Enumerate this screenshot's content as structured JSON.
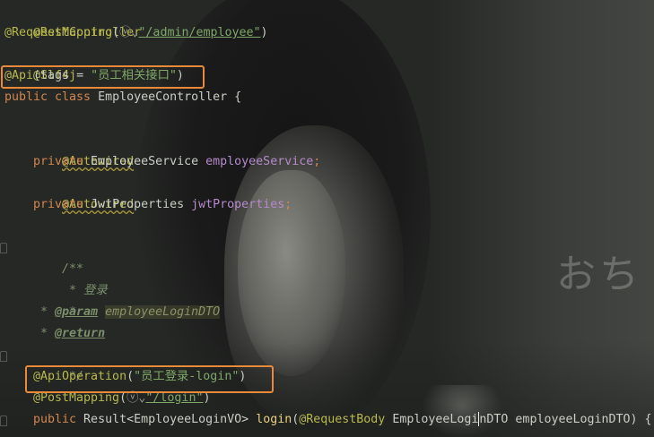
{
  "code_lines": {
    "l1": {
      "ann": "@RestController"
    },
    "l2": {
      "ann": "@RequestMapping",
      "open": "(",
      "glyph": "ⓥ⌄",
      "url": "\"/admin/employee\"",
      "close": ")"
    },
    "l3": {
      "ann": "@Slf4j"
    },
    "l4": {
      "ann": "@Api",
      "rest": "(tags = ",
      "str": "\"员工相关接口\"",
      "close": ")"
    },
    "l5": {
      "kw": "public class",
      "rest": " EmployeeController {"
    },
    "l7": {
      "ann": "@Autowired"
    },
    "l8": {
      "kw": "private",
      "type": " EmployeeService ",
      "field": "employeeService",
      "semi": ";"
    },
    "l9": {
      "ann": "@Autowired"
    },
    "l10": {
      "kw": "private",
      "type": " JwtProperties ",
      "field": "jwtProperties",
      "semi": ";"
    },
    "l12": {
      "cmt": "/**"
    },
    "l13": {
      "cmt": " * 登录"
    },
    "l14": {
      "cmt": " *"
    },
    "l15": {
      "cmt": " * ",
      "tag": "@param",
      "param": "employeeLoginDTO"
    },
    "l16": {
      "cmt": " * ",
      "tag": "@return"
    },
    "l17": {
      "cmt": " */"
    },
    "l18": {
      "ann": "@ApiOperation",
      "open": "(",
      "str": "\"员工登录-login\"",
      "close": ")"
    },
    "l19": {
      "ann": "@PostMapping",
      "open": "(",
      "glyph": "ⓥ⌄",
      "url": "\"/login\"",
      "close": ")"
    },
    "l20": {
      "kw": "public",
      "type": " Result<EmployeeLoginVO> ",
      "fn": "login",
      "open": "(",
      "ann": "@RequestBody",
      "ptype_a": " EmployeeLogi",
      "ptype_b": "nDTO",
      "pname": " employeeLoginDTO) {"
    }
  },
  "background": {
    "watermark": "おち"
  }
}
